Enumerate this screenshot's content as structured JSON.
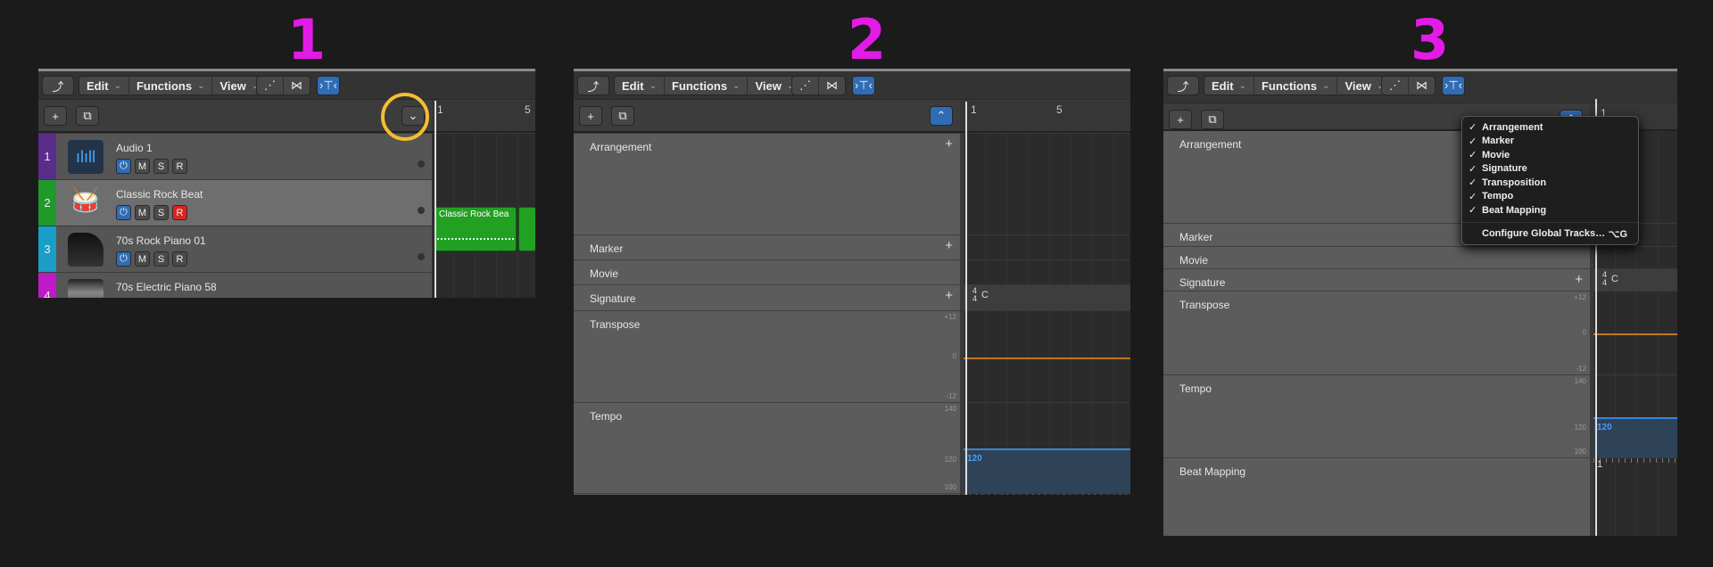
{
  "steps": [
    "1",
    "2",
    "3"
  ],
  "toolbar": {
    "edit": "Edit",
    "functions": "Functions",
    "view": "View"
  },
  "colors": {
    "highlight_ring": "#f4bd32",
    "step_label": "#e21be6",
    "region": "#22a022",
    "accent_blue": "#2f6cb5",
    "transpose_line": "#c0771f",
    "tempo_fill": "#2e4358",
    "tempo_line": "#3a84d8"
  },
  "ruler": {
    "bar1": "1",
    "bar5": "5"
  },
  "tracks": [
    {
      "num": "1",
      "name": "Audio 1",
      "color": "#5a2d8a",
      "icon": "waveform-icon",
      "record": false
    },
    {
      "num": "2",
      "name": "Classic Rock Beat",
      "color": "#1f9a2a",
      "icon": "drum-kit-icon",
      "record": true
    },
    {
      "num": "3",
      "name": "70s Rock Piano 01",
      "color": "#1a9dc6",
      "icon": "grand-piano-icon",
      "record": false
    },
    {
      "num": "4",
      "name": "70s Electric Piano 58",
      "color": "#c01ac8",
      "icon": "electric-piano-icon",
      "record": false
    }
  ],
  "track_buttons": {
    "mute": "M",
    "solo": "S",
    "record": "R"
  },
  "region": {
    "name": "Classic Rock Bea"
  },
  "global_tracks": {
    "arrangement": "Arrangement",
    "marker": "Marker",
    "movie": "Movie",
    "signature": "Signature",
    "transpose": "Transpose",
    "tempo": "Tempo",
    "beat_mapping": "Beat Mapping"
  },
  "transpose_scale": {
    "top": "+12",
    "mid": "0",
    "bottom": "-12"
  },
  "tempo_scale": {
    "top": "140",
    "mid": "120",
    "bottom": "100"
  },
  "tempo_value": "120",
  "signature": {
    "num": "4",
    "den": "4",
    "key": "C"
  },
  "beat_ruler": {
    "bar1": "1",
    "bar5": "5"
  },
  "menu": {
    "items": [
      {
        "label": "Arrangement",
        "checked": true
      },
      {
        "label": "Marker",
        "checked": true
      },
      {
        "label": "Movie",
        "checked": true
      },
      {
        "label": "Signature",
        "checked": true
      },
      {
        "label": "Transposition",
        "checked": true
      },
      {
        "label": "Tempo",
        "checked": true
      },
      {
        "label": "Beat Mapping",
        "checked": true
      }
    ],
    "configure": "Configure Global Tracks…",
    "shortcut": "⌥G",
    "check": "✓"
  }
}
